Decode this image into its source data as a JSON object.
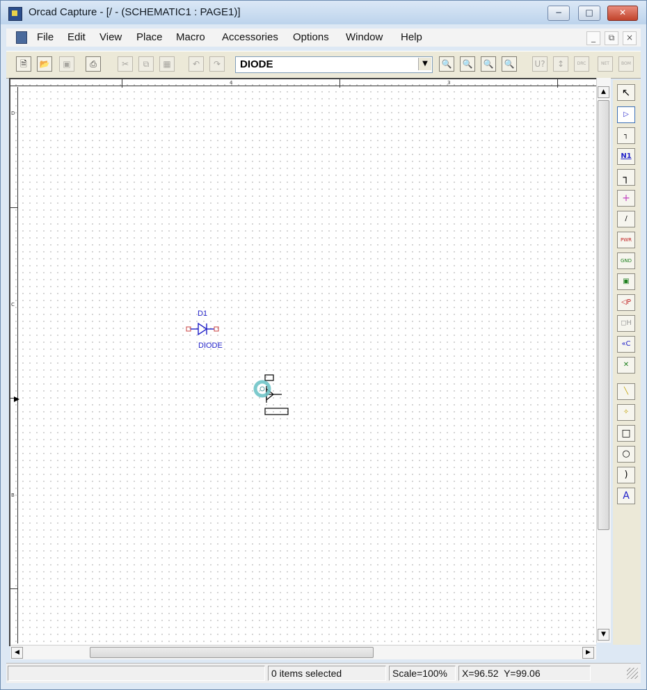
{
  "window": {
    "title": "Orcad Capture - [/ - (SCHEMATIC1 : PAGE1)]",
    "buttons": {
      "minimize": "−",
      "maximize": "□",
      "close": "✕"
    }
  },
  "menubar": {
    "items": [
      "File",
      "Edit",
      "View",
      "Place",
      "Macro",
      "Accessories",
      "Options",
      "Window",
      "Help"
    ],
    "mdi_buttons": {
      "minimize": "_",
      "restore": "⧉",
      "close": "×"
    }
  },
  "toolbar": {
    "part_combo": {
      "value": "DIODE",
      "arrow": "▼"
    },
    "left_icons": [
      "new-file-icon",
      "open-folder-icon",
      "save-icon",
      "print-icon",
      "cut-icon",
      "copy-icon",
      "paste-icon",
      "undo-icon",
      "redo-icon"
    ],
    "right_icons": [
      "zoom-in-icon",
      "zoom-out-icon",
      "zoom-area-icon",
      "zoom-all-icon",
      "annotate-icon",
      "back-annotate-icon",
      "drc-icon",
      "netlist-icon",
      "bom-icon"
    ],
    "right_labels": {
      "annotate": "U?",
      "drc": "DRC",
      "netlist": "NET",
      "bom": "BOM"
    }
  },
  "canvas": {
    "ruler_top_labels": [
      "4",
      "3"
    ],
    "ruler_left_labels": [
      "D",
      "C",
      "B"
    ],
    "parts": [
      {
        "ref": "D1",
        "value": "DIODE"
      }
    ]
  },
  "tool_palette": [
    {
      "name": "select-icon",
      "glyph": "↖"
    },
    {
      "name": "place-part-icon",
      "glyph": "▷"
    },
    {
      "name": "place-wire-icon",
      "glyph": "┐"
    },
    {
      "name": "place-net-alias-icon",
      "glyph": "N1"
    },
    {
      "name": "place-bus-icon",
      "glyph": "┐"
    },
    {
      "name": "place-junction-icon",
      "glyph": "+"
    },
    {
      "name": "place-bus-entry-icon",
      "glyph": "/"
    },
    {
      "name": "place-power-icon",
      "glyph": "PWR"
    },
    {
      "name": "place-ground-icon",
      "glyph": "GND"
    },
    {
      "name": "place-hierarchical-block-icon",
      "glyph": "▣"
    },
    {
      "name": "place-port-icon",
      "glyph": "◁P"
    },
    {
      "name": "place-pin-icon",
      "glyph": "◻H"
    },
    {
      "name": "place-off-page-connector-icon",
      "glyph": "«C"
    },
    {
      "name": "place-no-connect-icon",
      "glyph": "✕"
    },
    {
      "name": "place-line-icon",
      "glyph": "╲"
    },
    {
      "name": "place-polyline-icon",
      "glyph": "✧"
    },
    {
      "name": "place-rectangle-icon",
      "glyph": "□"
    },
    {
      "name": "place-ellipse-icon",
      "glyph": "○"
    },
    {
      "name": "place-arc-icon",
      "glyph": ")"
    },
    {
      "name": "place-text-icon",
      "glyph": "A"
    }
  ],
  "scrollbars": {
    "up": "▲",
    "down": "▼",
    "left": "◀",
    "right": "▶"
  },
  "statusbar": {
    "selection": "0 items selected",
    "scale": "Scale=100%",
    "coords": "X=96.52  Y=99.06"
  },
  "colors": {
    "part_blue": "#1e1ec8",
    "pin_red": "#c84040",
    "cursor_cyan": "#6fc4c8",
    "titlebar": "#bcd3ec"
  }
}
